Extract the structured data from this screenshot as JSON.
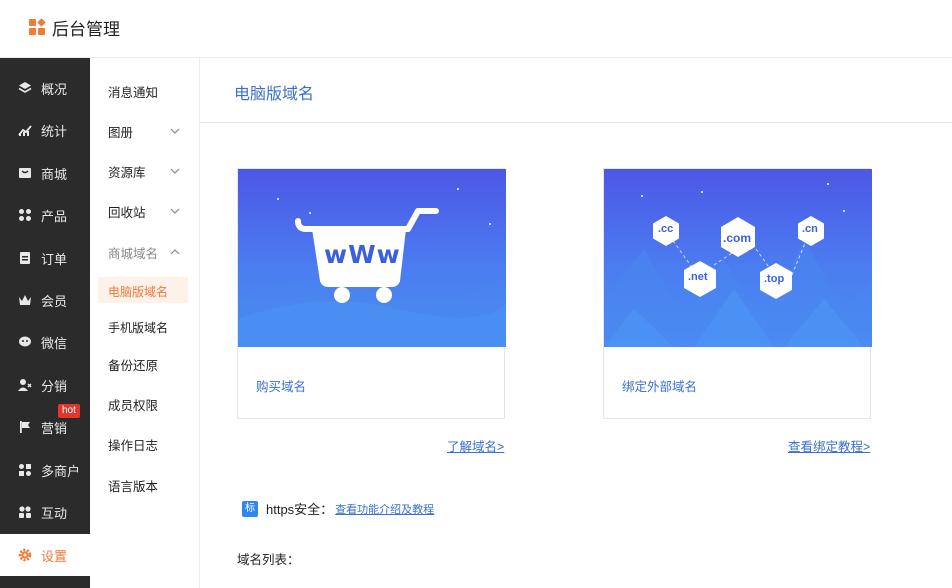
{
  "app": {
    "title": "后台管理",
    "accent": "#f07a3a",
    "link_color": "#3a6fd1"
  },
  "sidebar": {
    "items": [
      {
        "label": "概况",
        "icon": "layers-icon"
      },
      {
        "label": "统计",
        "icon": "chart-icon"
      },
      {
        "label": "商城",
        "icon": "store-icon"
      },
      {
        "label": "产品",
        "icon": "grid-icon"
      },
      {
        "label": "订单",
        "icon": "clipboard-icon"
      },
      {
        "label": "会员",
        "icon": "crown-icon"
      },
      {
        "label": "微信",
        "icon": "chat-icon"
      },
      {
        "label": "分销",
        "icon": "users-icon"
      },
      {
        "label": "营销",
        "icon": "flag-icon"
      },
      {
        "label": "多商户",
        "icon": "merchant-icon"
      },
      {
        "label": "互动",
        "icon": "interact-icon"
      },
      {
        "label": "设置",
        "icon": "gear-icon"
      }
    ],
    "hot_badge": "hot"
  },
  "subnav": {
    "items": [
      {
        "label": "消息通知"
      },
      {
        "label": "图册"
      },
      {
        "label": "资源库"
      },
      {
        "label": "回收站"
      },
      {
        "label": "商城域名"
      },
      {
        "label": "电脑版域名"
      },
      {
        "label": "手机版域名"
      },
      {
        "label": "备份还原"
      },
      {
        "label": "成员权限"
      },
      {
        "label": "操作日志"
      },
      {
        "label": "语言版本"
      }
    ]
  },
  "main": {
    "title": "电脑版域名",
    "cards": [
      {
        "label": "购买域名",
        "link": "了解域名>",
        "art_text": "wWw"
      },
      {
        "label": "绑定外部域名",
        "link": "查看绑定教程>",
        "tlds": [
          ".cc",
          ".com",
          ".cn",
          ".net",
          ".top"
        ]
      }
    ],
    "https": {
      "badge": "标",
      "label": "https安全：",
      "link": "查看功能介绍及教程"
    },
    "domain_list_title": "域名列表："
  }
}
